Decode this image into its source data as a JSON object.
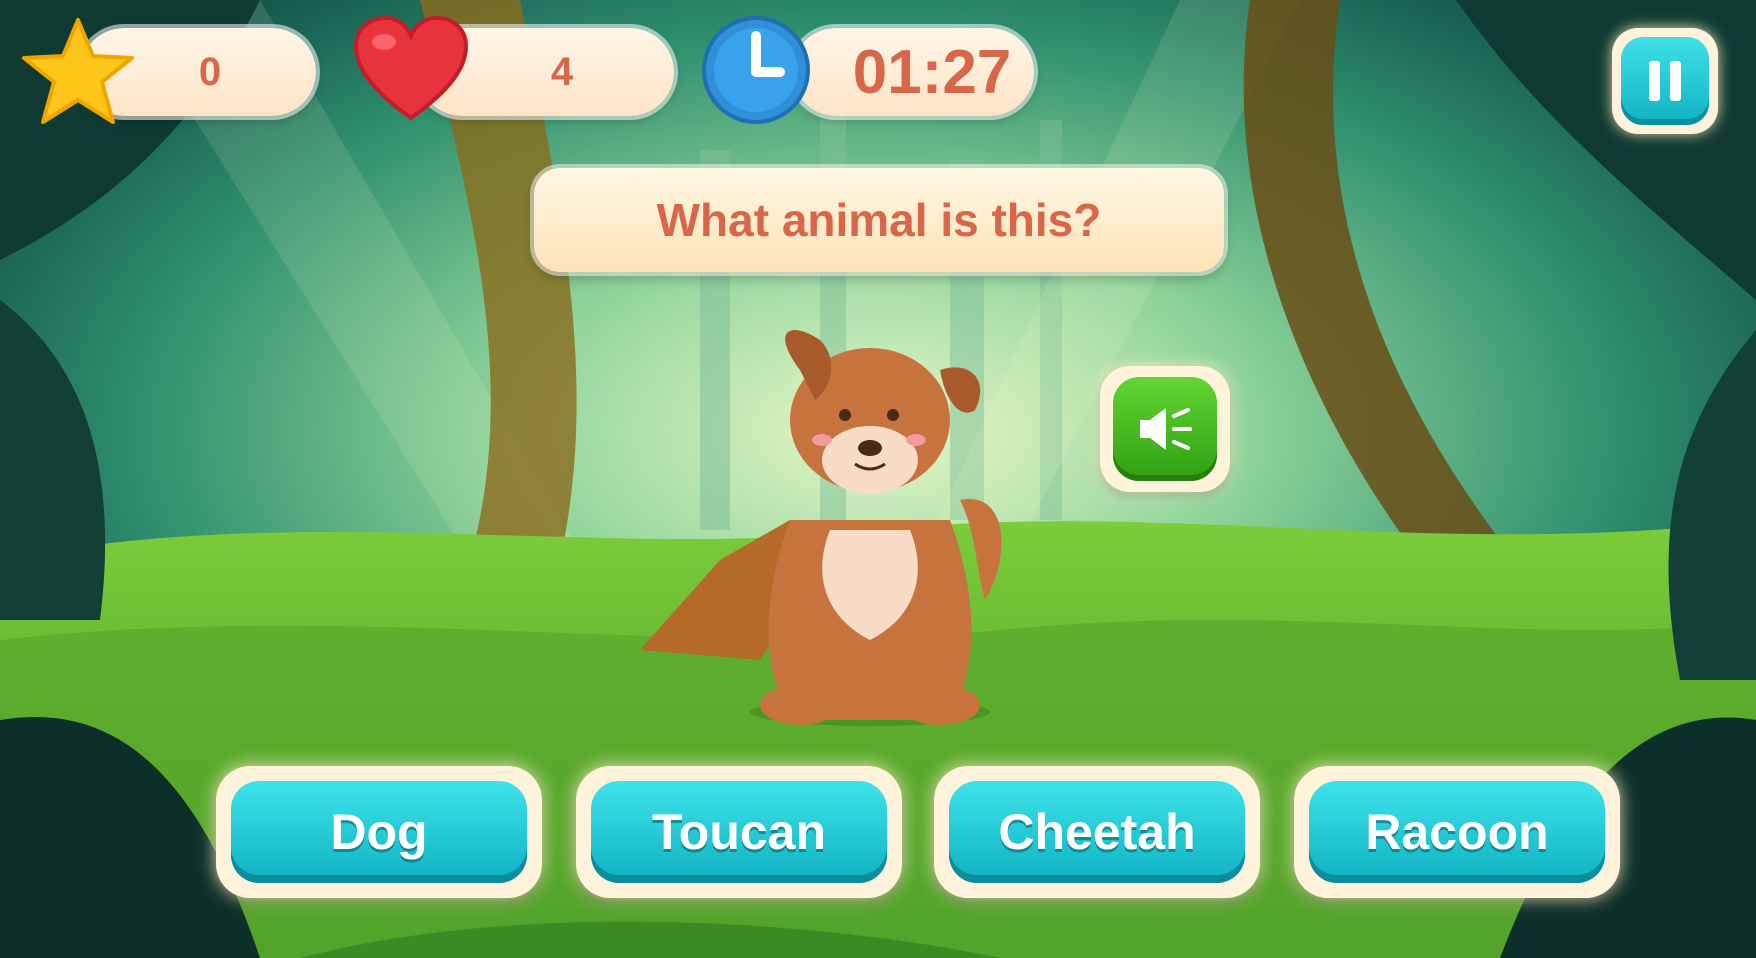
{
  "hud": {
    "score": "0",
    "lives": "4",
    "timer": "01:27"
  },
  "question": {
    "text": "What animal is this?"
  },
  "answers": [
    "Dog",
    "Toucan",
    "Cheetah",
    "Racoon"
  ],
  "icons": {
    "score": "star-icon",
    "lives": "heart-icon",
    "timer": "clock-icon",
    "pause": "pause-icon",
    "sound": "speaker-icon"
  },
  "colors": {
    "accent_text": "#d8674a",
    "answer_button": "#1cc3d1",
    "sound_button": "#3fb51d",
    "pill_bg": "#fdebd3"
  }
}
